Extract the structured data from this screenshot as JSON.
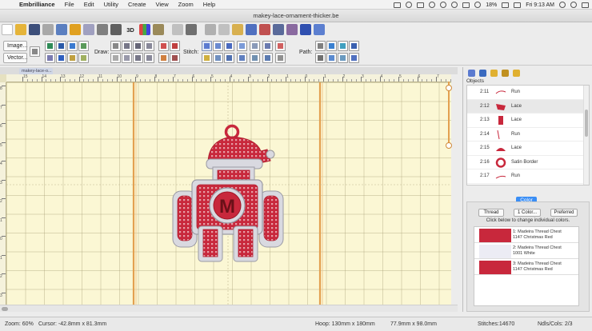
{
  "menubar": {
    "app": "Embrilliance",
    "items": [
      "File",
      "Edit",
      "Utility",
      "Create",
      "View",
      "Zoom",
      "Help"
    ],
    "battery": "18%",
    "clock": "Fri 9:13 AM"
  },
  "window": {
    "title": "makey-lace-ornament-thicker.be"
  },
  "toolbar": {
    "label_3d": "3D",
    "image_button": "Image...",
    "vector_button": "Vector...",
    "draw_label": "Draw:",
    "stitch_label": "Stitch:",
    "path_label": "Path:"
  },
  "canvas": {
    "tab_label": "makey-lace-o...",
    "design_letter": "M",
    "ruler_h_labels": [
      "15",
      "14",
      "13",
      "12",
      "11",
      "10",
      "9",
      "8",
      "7",
      "6",
      "5",
      "4",
      "3",
      "2",
      "1",
      "0",
      "1",
      "2",
      "3",
      "4",
      "5",
      "6",
      "7",
      "8",
      "9",
      "10",
      "11",
      "12",
      "13",
      "14",
      "15"
    ],
    "ruler_v_labels": [
      "8",
      "7",
      "6",
      "5",
      "4",
      "3",
      "2",
      "1",
      "0",
      "1",
      "2",
      "3",
      "4",
      "5",
      "6",
      "7",
      "8"
    ]
  },
  "objects": {
    "header": "Objects",
    "rows": [
      {
        "num": "2:11",
        "type": "Run"
      },
      {
        "num": "2:12",
        "type": "Lace"
      },
      {
        "num": "2:13",
        "type": "Lace"
      },
      {
        "num": "2:14",
        "type": "Run"
      },
      {
        "num": "2:15",
        "type": "Lace"
      },
      {
        "num": "2:16",
        "type": "Satin Border"
      },
      {
        "num": "2:17",
        "type": "Run"
      }
    ]
  },
  "color_panel": {
    "tab": "Color",
    "thread_button": "Thread",
    "one_color_button": "1 Color...",
    "preferred_button": "Preferred",
    "hint": "Click below to change individual colors.",
    "colors": [
      {
        "line1": "1: Madeira Thread Chest",
        "line2": "1147 Christmas Red",
        "hex": "#c8283c"
      },
      {
        "line1": "2: Madeira Thread Chest",
        "line2": "1001 White",
        "hex": "#ececf4"
      },
      {
        "line1": "3: Madeira Thread Chest",
        "line2": "1147 Christmas Red",
        "hex": "#c8283c"
      }
    ]
  },
  "statusbar": {
    "zoom": "Zoom: 60%",
    "cursor": "Cursor: -42.8mm x 81.3mm",
    "hoop": "Hoop: 130mm x 180mm",
    "size": "77.9mm x 98.0mm",
    "stitches": "Stitches:14670",
    "ndls": "Ndls/Cols: 2/3"
  },
  "colors": {
    "accent": "#3a8ef5",
    "red": "#c8283c",
    "canvas": "#fbf7d4"
  }
}
